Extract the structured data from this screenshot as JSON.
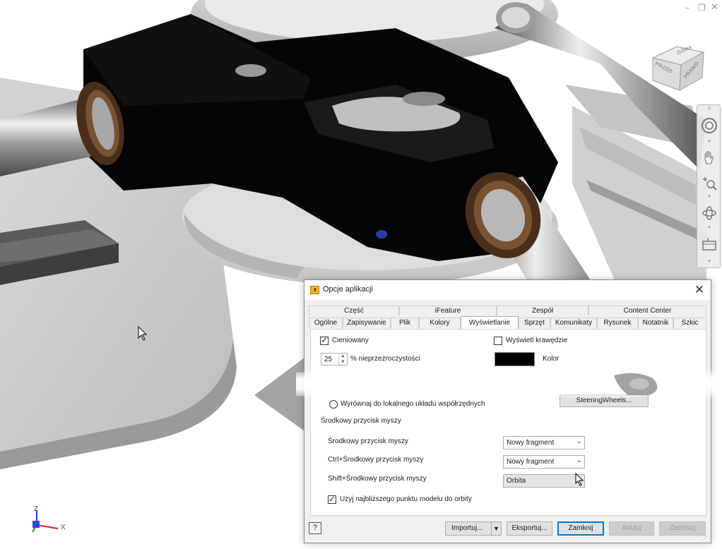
{
  "window": {
    "minimize_glyph": "–",
    "restore_glyph": "❐"
  },
  "viewcube": {
    "top_label": "GÓRA",
    "front_label": "PRZÓD",
    "right_label": "PRAWO"
  },
  "navbar": {
    "items": [
      "steering-wheel-icon",
      "pan-hand-icon",
      "zoom-icon",
      "orbit-icon",
      "look-at-icon"
    ]
  },
  "triad": {
    "z_label": "Z",
    "x_label": "X"
  },
  "dialog": {
    "title": "Opcje aplikacji",
    "close_glyph": "✕",
    "tabs_top": [
      "Część",
      "iFeature",
      "Zespół",
      "Content Center"
    ],
    "tabs_bottom": [
      "Ogólne",
      "Zapisywanie",
      "Plik",
      "Kolory",
      "Wyświetlanie",
      "Sprzęt",
      "Komunikaty",
      "Rysunek",
      "Notatnik",
      "Szkic"
    ],
    "active_tab": "Wyświetlanie",
    "shaded": {
      "label": "Cieniowany",
      "checked": true,
      "opacity_value": "25",
      "opacity_label": "% nieprzezroczystości"
    },
    "edges": {
      "label": "Wyświetl krawędzie",
      "checked": false,
      "color_label": "Kolor",
      "color": "#000000"
    },
    "align_radio_label": "Wyrównaj do lokalnego układu współrzędnych",
    "steering_button": "SteeringWheels...",
    "mouse_section_title": "Środkowy przycisk myszy",
    "mouse_rows": [
      {
        "label": "Środkowy przycisk myszy",
        "value": "Nowy fragment"
      },
      {
        "label": "Ctrl+Środkowy przycisk myszy",
        "value": "Nowy fragment"
      },
      {
        "label": "Shift+Środkowy przycisk myszy",
        "value": "Orbita"
      }
    ],
    "nearest_point": {
      "label": "Użyj najbliższego punktu modelu do orbity",
      "checked": true
    },
    "footer": {
      "help_glyph": "?",
      "import_label": "Importuj...",
      "export_label": "Eksportuj...",
      "close_label": "Zamknij",
      "cancel_label": "Anuluj",
      "apply_label": "Zastosuj"
    }
  },
  "colors": {
    "dialog_bg": "#f0f0f0",
    "accent": "#0078d7",
    "part_dark": "#000000",
    "part_metal": "#c8c8c8",
    "bushing": "#5a3a24"
  }
}
